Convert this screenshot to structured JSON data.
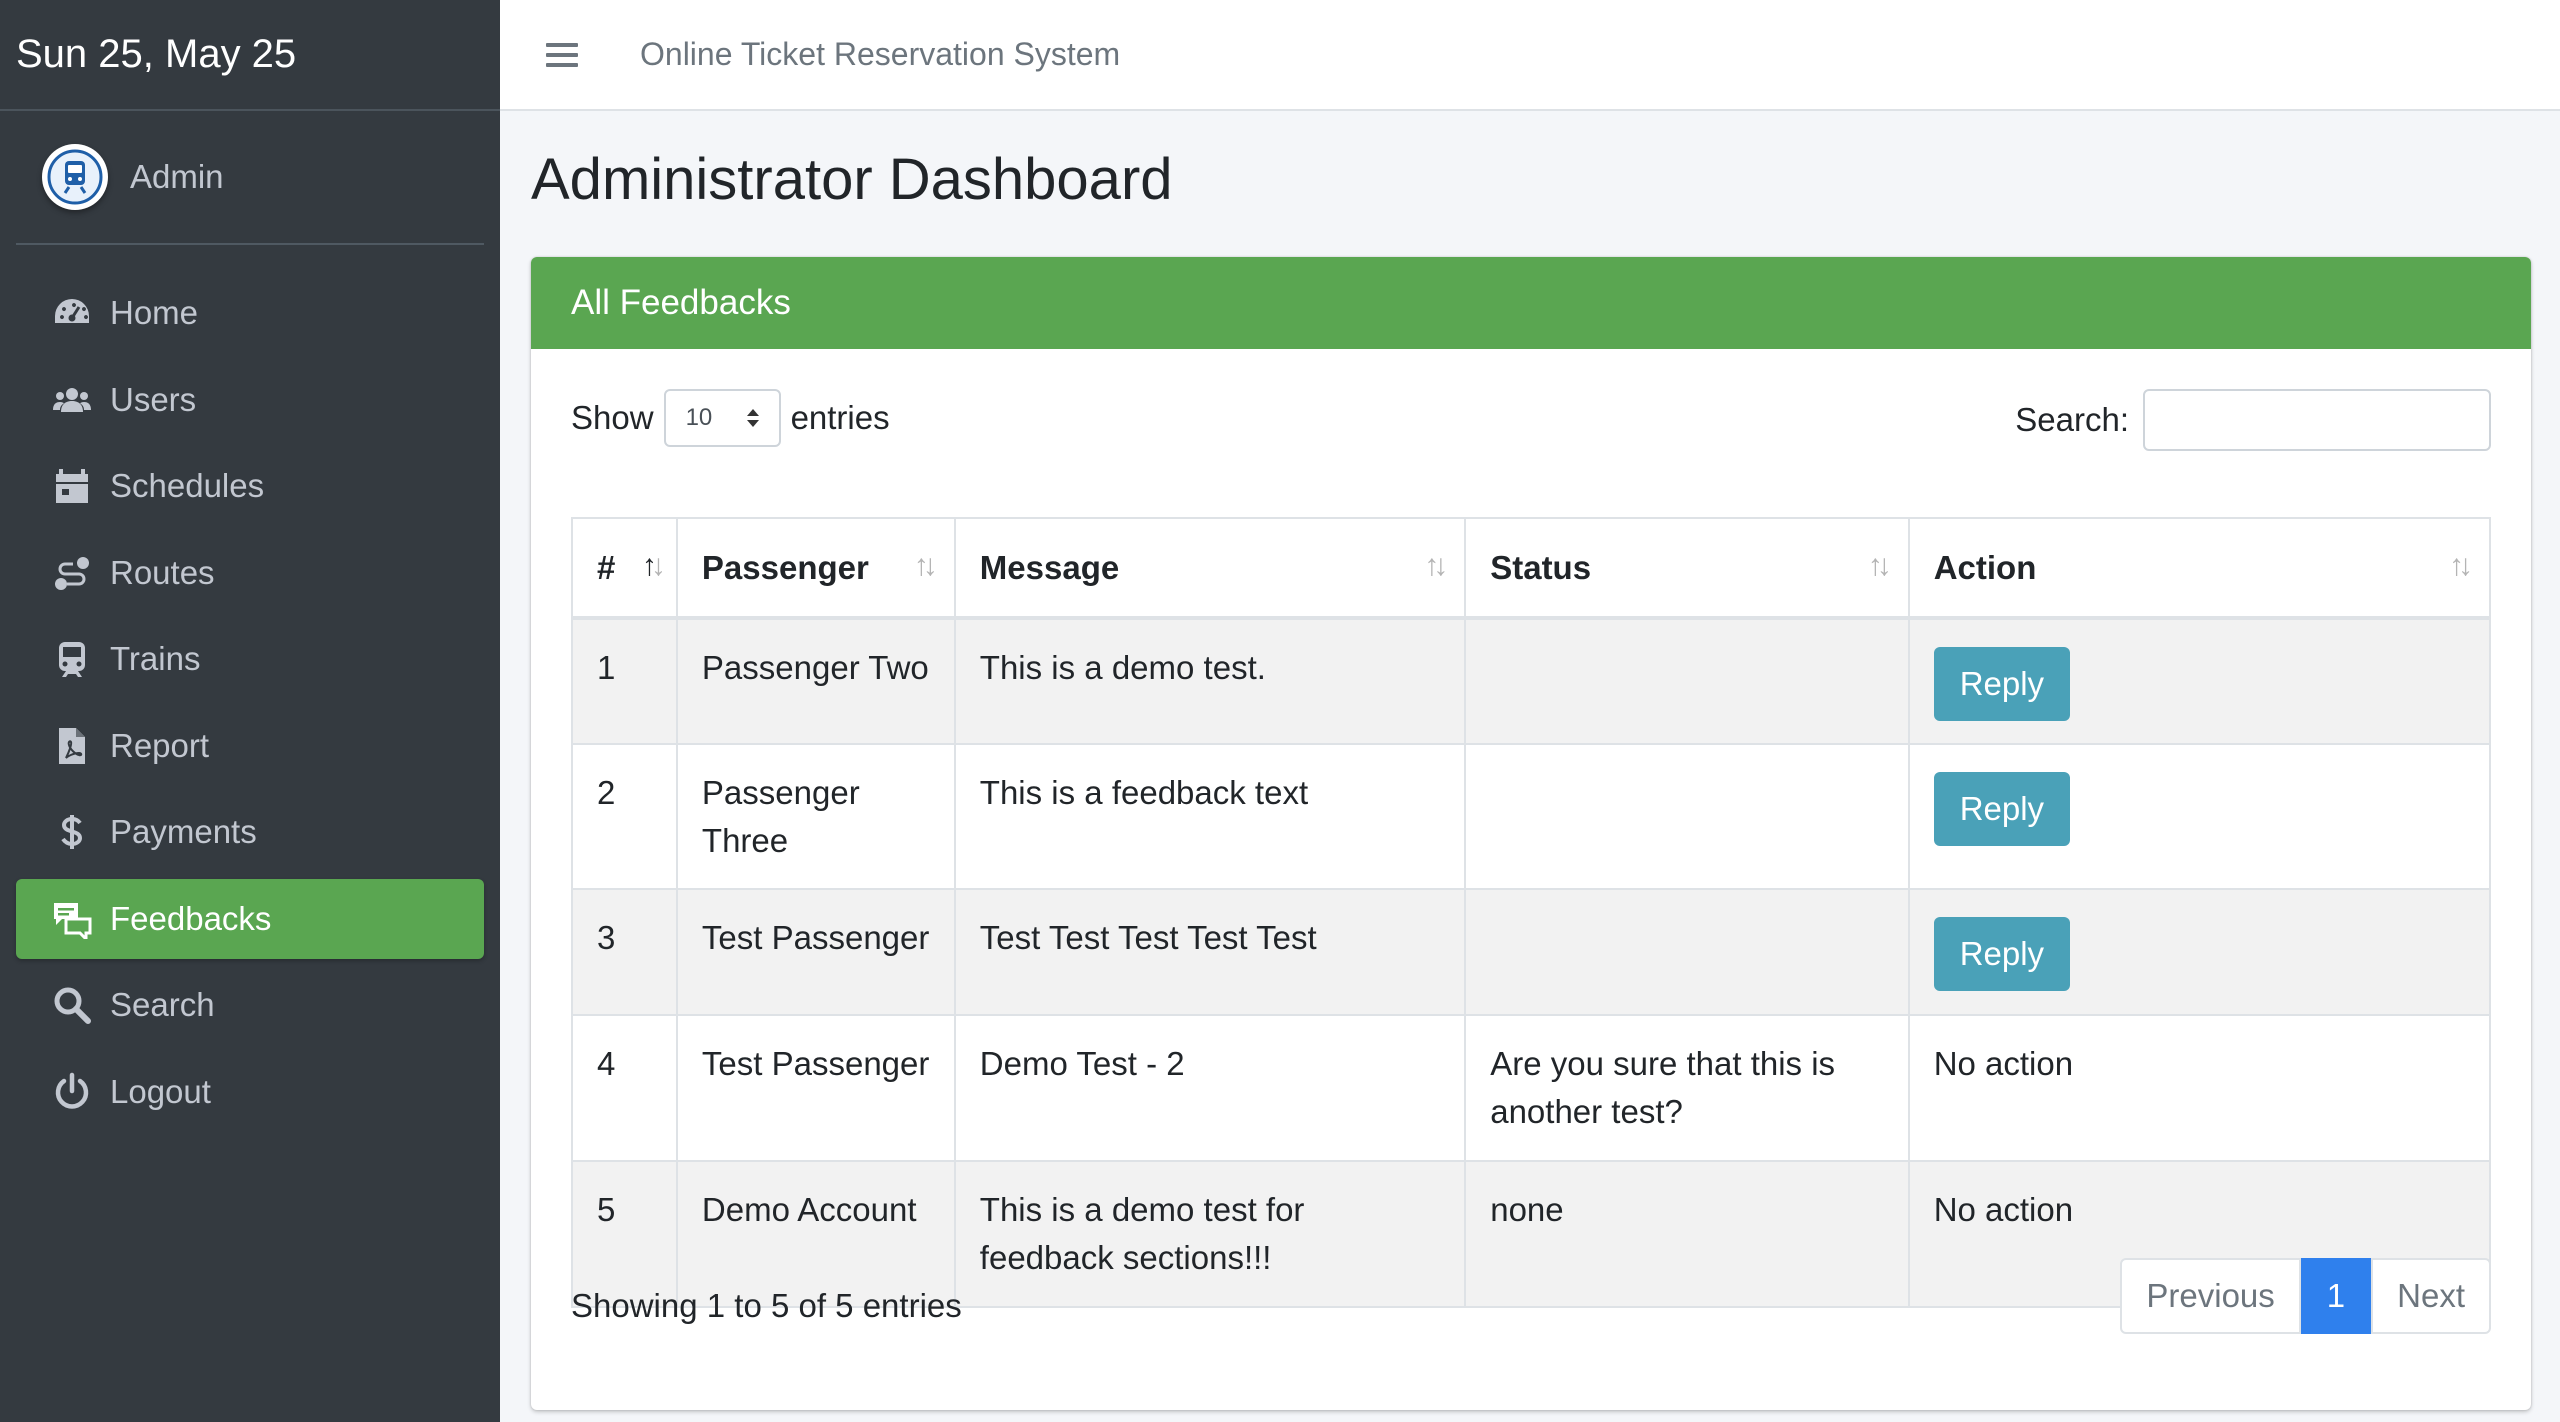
{
  "brand": {
    "date_text": "Sun 25, May 25"
  },
  "user": {
    "name": "Admin"
  },
  "sidebar": {
    "items": [
      {
        "label": "Home",
        "icon": "dashboard-icon"
      },
      {
        "label": "Users",
        "icon": "users-icon"
      },
      {
        "label": "Schedules",
        "icon": "calendar-icon"
      },
      {
        "label": "Routes",
        "icon": "route-icon"
      },
      {
        "label": "Trains",
        "icon": "train-icon"
      },
      {
        "label": "Report",
        "icon": "pdf-file-icon"
      },
      {
        "label": "Payments",
        "icon": "dollar-icon"
      },
      {
        "label": "Feedbacks",
        "icon": "feedback-icon",
        "active": true
      },
      {
        "label": "Search",
        "icon": "search-icon"
      },
      {
        "label": "Logout",
        "icon": "power-icon"
      }
    ]
  },
  "header": {
    "title": "Online Ticket Reservation System"
  },
  "page": {
    "title": "Administrator Dashboard"
  },
  "card": {
    "title": "All Feedbacks",
    "show_label": "Show",
    "entries_label": "entries",
    "page_length": "10",
    "search_label": "Search:",
    "search_value": ""
  },
  "table": {
    "columns": [
      "#",
      "Passenger",
      "Message",
      "Status",
      "Action"
    ],
    "rows": [
      {
        "num": "1",
        "passenger": "Passenger Two",
        "message": "This is a demo test.",
        "status": "",
        "action": "Reply"
      },
      {
        "num": "2",
        "passenger": "Passenger Three",
        "message": "This is a feedback text",
        "status": "",
        "action": "Reply"
      },
      {
        "num": "3",
        "passenger": "Test Passenger",
        "message": "Test Test Test Test Test",
        "status": "",
        "action": "Reply"
      },
      {
        "num": "4",
        "passenger": "Test Passenger",
        "message": "Demo Test - 2",
        "status": "Are you sure that this is another test?",
        "action": "No action"
      },
      {
        "num": "5",
        "passenger": "Demo Account",
        "message": "This is a demo test for feedback sections!!!",
        "status": "none",
        "action": "No action"
      }
    ]
  },
  "footer": {
    "info": "Showing 1 to 5 of 5 entries",
    "prev": "Previous",
    "current_page": "1",
    "next": "Next"
  },
  "colors": {
    "sidebar_bg": "#343a40",
    "accent_green": "#5aa651",
    "reply_button": "#4aa1b8",
    "page_active": "#2f80ed"
  }
}
